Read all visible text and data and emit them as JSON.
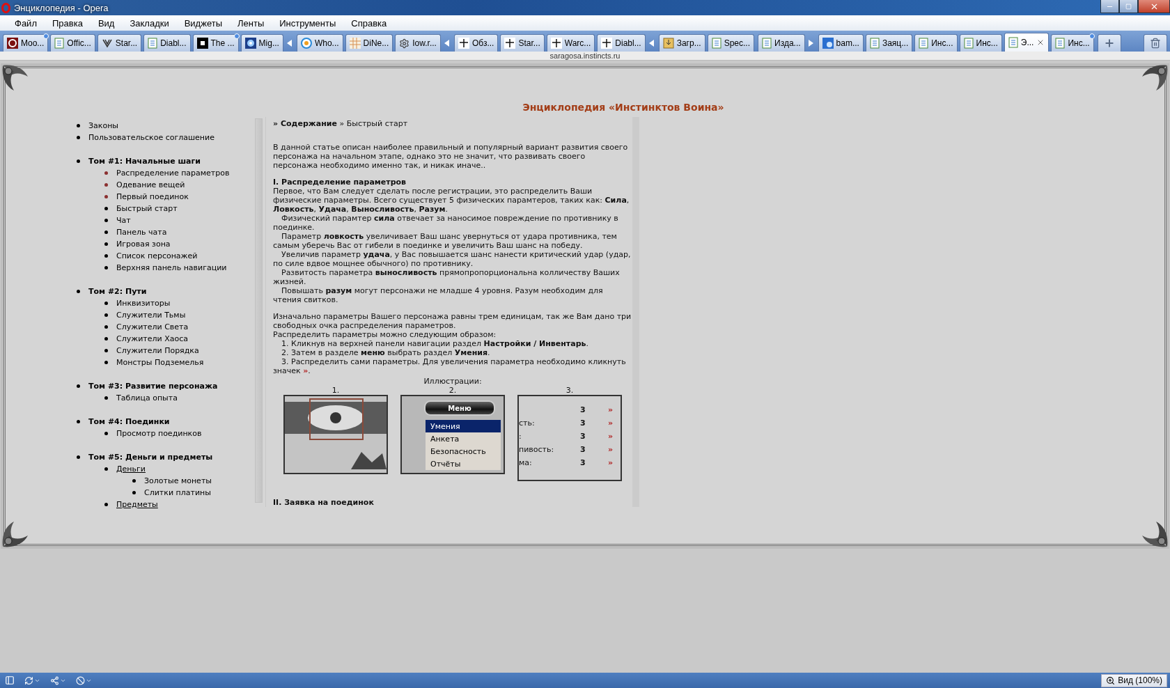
{
  "window": {
    "title": "Энциклопедия - Opera"
  },
  "menu": [
    "Файл",
    "Правка",
    "Вид",
    "Закладки",
    "Виджеты",
    "Ленты",
    "Инструменты",
    "Справка"
  ],
  "tab_groups": [
    {
      "kind": "stack",
      "expanded": true,
      "tabs": [
        {
          "label": "Moo...",
          "kind": "opera",
          "unread": true,
          "selected": false
        },
        {
          "label": "Offic...",
          "kind": "page",
          "unread": false,
          "selected": false
        },
        {
          "label": "Star...",
          "kind": "emblem",
          "unread": false,
          "selected": false
        },
        {
          "label": "Diabl...",
          "kind": "page",
          "unread": false,
          "selected": false
        },
        {
          "label": "The ...",
          "kind": "square",
          "unread": true,
          "selected": false
        },
        {
          "label": "Mig...",
          "kind": "circle",
          "unread": false,
          "selected": false
        }
      ]
    },
    {
      "kind": "stack",
      "expanded": true,
      "tabs": [
        {
          "label": "Who...",
          "kind": "ru",
          "unread": false,
          "selected": false
        },
        {
          "label": "DiNe...",
          "kind": "grid",
          "unread": false,
          "selected": false
        },
        {
          "label": "Iow.r...",
          "kind": "gear",
          "unread": false,
          "selected": false
        }
      ]
    },
    {
      "kind": "stack",
      "expanded": true,
      "tabs": [
        {
          "label": "Обз...",
          "kind": "arbse",
          "unread": false,
          "selected": false
        },
        {
          "label": "Star...",
          "kind": "arbse",
          "unread": false,
          "selected": false
        },
        {
          "label": "Warc...",
          "kind": "arbse",
          "unread": false,
          "selected": false
        },
        {
          "label": "Diabl...",
          "kind": "arbse",
          "unread": false,
          "selected": false
        }
      ]
    },
    {
      "kind": "loose",
      "tabs": [
        {
          "label": "Загр...",
          "kind": "download",
          "unread": false,
          "selected": false
        },
        {
          "label": "Spec...",
          "kind": "page",
          "unread": false,
          "selected": false
        }
      ]
    },
    {
      "kind": "stack",
      "expanded": false,
      "tabs": [
        {
          "label": "Изда...",
          "kind": "page",
          "unread": false,
          "selected": false
        }
      ]
    },
    {
      "kind": "loose",
      "tabs": [
        {
          "label": "bam...",
          "kind": "photo",
          "unread": false,
          "selected": false
        },
        {
          "label": "Заяц...",
          "kind": "page",
          "unread": false,
          "selected": false
        },
        {
          "label": "Инс...",
          "kind": "page",
          "unread": false,
          "selected": false
        },
        {
          "label": "Инс...",
          "kind": "page",
          "unread": false,
          "selected": false
        },
        {
          "label": "Э...",
          "kind": "page",
          "unread": false,
          "selected": true
        },
        {
          "label": "Инс...",
          "kind": "page",
          "unread": true,
          "selected": false
        }
      ]
    }
  ],
  "address": "saragosa.instincts.ru",
  "page": {
    "heading": "Энциклопедия «Инстинктов Воина»",
    "nav": [
      {
        "label": "Законы",
        "kind": "plain"
      },
      {
        "label": "Пользовательское соглашение",
        "kind": "plain"
      },
      {
        "label": "Том #1: Начальные шаги",
        "kind": "volume",
        "children": [
          {
            "label": "Распределение параметров",
            "kind": "plain",
            "color": "#8b3030"
          },
          {
            "label": "Одевание вещей",
            "kind": "plain",
            "color": "#8b3030"
          },
          {
            "label": "Первый поединок",
            "kind": "plain",
            "color": "#8b3030"
          },
          {
            "label": "Быстрый старт",
            "kind": "plain",
            "color": "#000000"
          },
          {
            "label": "Чат",
            "kind": "plain",
            "color": "#000000"
          },
          {
            "label": "Панель чата",
            "kind": "plain",
            "color": "#000000"
          },
          {
            "label": "Игровая зона",
            "kind": "plain",
            "color": "#000000"
          },
          {
            "label": "Список персонажей",
            "kind": "plain",
            "color": "#000000"
          },
          {
            "label": "Верхняя панель навигации",
            "kind": "plain",
            "color": "#000000"
          }
        ]
      },
      {
        "label": "Том #2: Пути",
        "kind": "volume",
        "children": [
          {
            "label": "Инквизиторы",
            "kind": "plain",
            "color": "#000000"
          },
          {
            "label": "Служители Тьмы",
            "kind": "plain",
            "color": "#000000"
          },
          {
            "label": "Служители Света",
            "kind": "plain",
            "color": "#000000"
          },
          {
            "label": "Служители Хаоса",
            "kind": "plain",
            "color": "#000000"
          },
          {
            "label": "Служители Порядка",
            "kind": "plain",
            "color": "#000000"
          },
          {
            "label": "Монстры Подземелья",
            "kind": "plain",
            "color": "#000000"
          }
        ]
      },
      {
        "label": "Том #3: Развитие персонажа",
        "kind": "volume",
        "children": [
          {
            "label": "Таблица опыта",
            "kind": "plain",
            "color": "#000000"
          }
        ]
      },
      {
        "label": "Том #4: Поединки",
        "kind": "volume",
        "children": [
          {
            "label": "Просмотр поединков",
            "kind": "plain",
            "color": "#000000"
          }
        ]
      },
      {
        "label": "Том #5: Деньги и предметы",
        "kind": "volume",
        "children": [
          {
            "label": "Деньги",
            "kind": "link",
            "color": "#000000",
            "children": [
              {
                "label": "Золотые монеты",
                "kind": "plain",
                "color": "#000000"
              },
              {
                "label": "Слитки платины",
                "kind": "plain",
                "color": "#000000"
              }
            ]
          },
          {
            "label": "Предметы",
            "kind": "link",
            "color": "#000000"
          }
        ]
      }
    ],
    "article": {
      "breadcrumb": "**» Содержание** » Быстрый старт",
      "blocks": [
        {
          "kind": "para",
          "text": "В данной статье описан наиболее правильный и популярный вариант развития своего персонажа на начальном этапе, однако это не значит, что развивать своего персонажа необходимо именно так, и никак иначе.."
        },
        {
          "kind": "gap"
        },
        {
          "kind": "heading",
          "text": "I. Распределение параметров"
        },
        {
          "kind": "para",
          "text": "Первое, что Вам следует сделать после регистрации, это распределить Ваши физические параметры. Всего существует 5 физических парамтеров, таких как: **Сила**, **Ловкость**, **Удача**, **Выносливость**, **Разум**."
        },
        {
          "kind": "indent",
          "text": "Физический парамтер **сила** отвечает за наносимое повреждение по противнику в поединке."
        },
        {
          "kind": "indent",
          "text": "Параметр **ловкость** увеличивает Ваш шанс увернуться от удара противника, тем самым уберечь Вас от гибели в поединке и увеличить Ваш шанс на победу."
        },
        {
          "kind": "indent",
          "text": "Увеличив параметр **удача**, у Вас повышается шанс нанести критический удар (удар, по силе вдвое мощнее обычного) по противнику."
        },
        {
          "kind": "indent",
          "text": "Развитость параметра **выносливость** прямопропорциональна колличеству Ваших жизней."
        },
        {
          "kind": "indent",
          "text": "Повышать **разум** могут персонажи не младше 4 уровня. Разум необходим для чтения свитков."
        },
        {
          "kind": "gap"
        },
        {
          "kind": "para",
          "text": "Изначально параметры Вашего персонажа равны трем единицам, так же Вам дано три свободных очка распределения параметров."
        },
        {
          "kind": "para",
          "text": "Распределить параметры можно следующим образом:"
        },
        {
          "kind": "indent",
          "text": "1. Кликнув на верхней панели навигации раздел **Настройки / Инвентарь**."
        },
        {
          "kind": "indent",
          "text": "2. Затем в разделе **меню** выбрать раздел **Умения**."
        },
        {
          "kind": "indent",
          "text": "3. Распределить сами параметры. Для увеличения параметра необходимо кликнуть значек",
          "marker": "»",
          "end": "."
        }
      ],
      "illustrations_caption": "Иллюстрации:",
      "figures": [
        {
          "number": "1.",
          "kind": "toolbar"
        },
        {
          "number": "2.",
          "kind": "menu",
          "button": "Меню",
          "items": [
            {
              "label": "Умения",
              "selected": true
            },
            {
              "label": "Анкета",
              "selected": false
            },
            {
              "label": "Безопасность",
              "selected": false
            },
            {
              "label": "Отчёты",
              "selected": false
            }
          ]
        },
        {
          "number": "3.",
          "kind": "stats",
          "rows": [
            {
              "value": "3",
              "arrow": "»"
            },
            {
              "label": "сть:",
              "value": "3",
              "arrow": "»"
            },
            {
              "label": ":",
              "value": "3",
              "arrow": "»"
            },
            {
              "label": "пивость:",
              "value": "3",
              "arrow": "»"
            },
            {
              "label": "ма:",
              "value": "3",
              "arrow": "»"
            }
          ]
        }
      ],
      "next_heading": "II. Заявка на поединок"
    }
  },
  "status_bar": {
    "zoom": "Вид (100%)"
  }
}
